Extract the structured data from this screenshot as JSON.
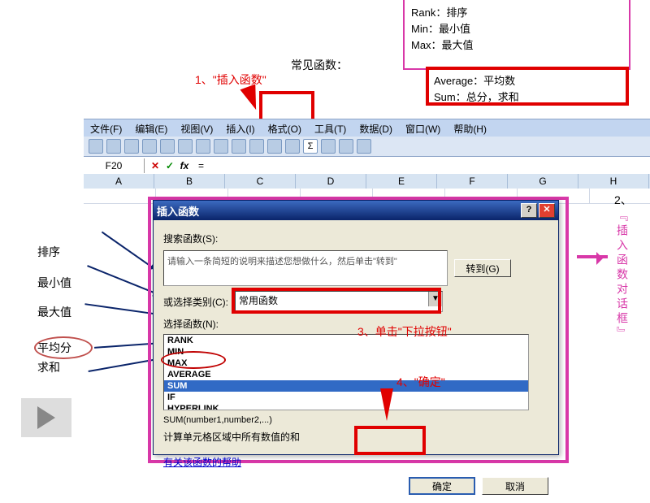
{
  "legend": {
    "rank": "Rank：排序",
    "min": "Min：最小值",
    "max": "Max：最大值",
    "avg": "Average：平均数",
    "sum": "Sum：总分，求和"
  },
  "caption_top": "常见函数：",
  "steps": {
    "s1": "1、\"插入函数\"",
    "s3": "3、单击\"下拉按钮\"",
    "s4": "4、\"确定\""
  },
  "menu": {
    "file": "文件(F)",
    "edit": "编辑(E)",
    "view": "视图(V)",
    "insert": "插入(I)",
    "format": "格式(O)",
    "tools": "工具(T)",
    "data": "数据(D)",
    "window": "窗口(W)",
    "help": "帮助(H)"
  },
  "cellref": "F20",
  "formula_eq": "=",
  "cols": [
    "A",
    "B",
    "C",
    "D",
    "E",
    "F",
    "G",
    "H"
  ],
  "left_labels": {
    "rank": "排序",
    "min": "最小值",
    "max": "最大值",
    "avg": "平均分",
    "sum": "求和"
  },
  "right_vert": "『插入函数对话框』",
  "two": "2、",
  "dialog": {
    "title": "插入函数",
    "search_label": "搜索函数(S):",
    "search_hint": "请输入一条简短的说明来描述您想做什么，然后单击\"转到\"",
    "goto": "转到(G)",
    "category_label": "或选择类别(C):",
    "category_value": "常用函数",
    "select_label": "选择函数(N):",
    "functions": [
      "RANK",
      "MIN",
      "MAX",
      "AVERAGE",
      "SUM",
      "IF",
      "HYPERLINK"
    ],
    "selected_index": 4,
    "syntax": "SUM(number1,number2,...)",
    "desc": "计算单元格区域中所有数值的和",
    "help": "有关该函数的帮助",
    "ok": "确定",
    "cancel": "取消"
  }
}
